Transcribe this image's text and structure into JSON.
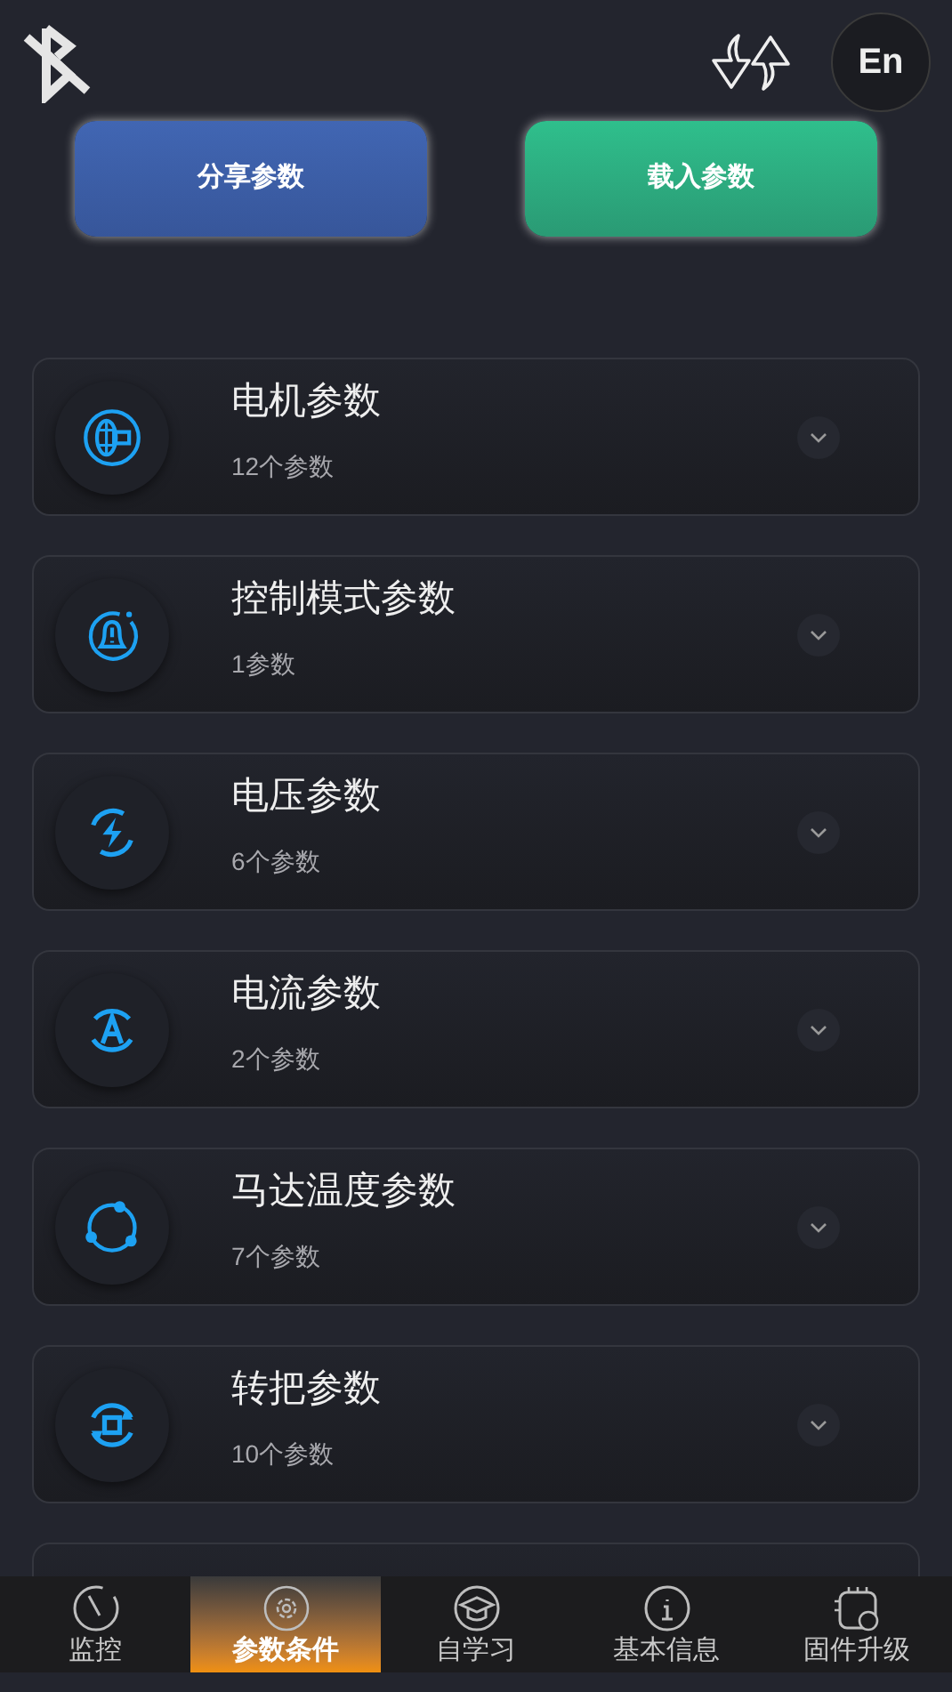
{
  "header": {
    "language_button": "En"
  },
  "actions": [
    {
      "label": "分享参数",
      "kind": "share"
    },
    {
      "label": "载入参数",
      "kind": "load"
    }
  ],
  "groups": [
    {
      "title": "电机参数",
      "subtitle": "12个参数",
      "kind": "motor",
      "expanded": false
    },
    {
      "title": "控制模式参数",
      "subtitle": "1参数",
      "kind": "bell",
      "expanded": false
    },
    {
      "title": "电压参数",
      "subtitle": "6个参数",
      "kind": "voltage",
      "expanded": false
    },
    {
      "title": "电流参数",
      "subtitle": "2个参数",
      "kind": "current",
      "expanded": false
    },
    {
      "title": "马达温度参数",
      "subtitle": "7个参数",
      "kind": "temperature",
      "expanded": false
    },
    {
      "title": "转把参数",
      "subtitle": "10个参数",
      "kind": "throttle",
      "expanded": false
    },
    {
      "kind": "partial"
    }
  ],
  "nav": [
    {
      "label": "监控",
      "kind": "gauge",
      "selected": false
    },
    {
      "label": "参数条件",
      "kind": "gear",
      "selected": true
    },
    {
      "label": "自学习",
      "kind": "cap",
      "selected": false
    },
    {
      "label": "基本信息",
      "kind": "info",
      "selected": false
    },
    {
      "label": "固件升级",
      "kind": "chip",
      "selected": false
    }
  ]
}
